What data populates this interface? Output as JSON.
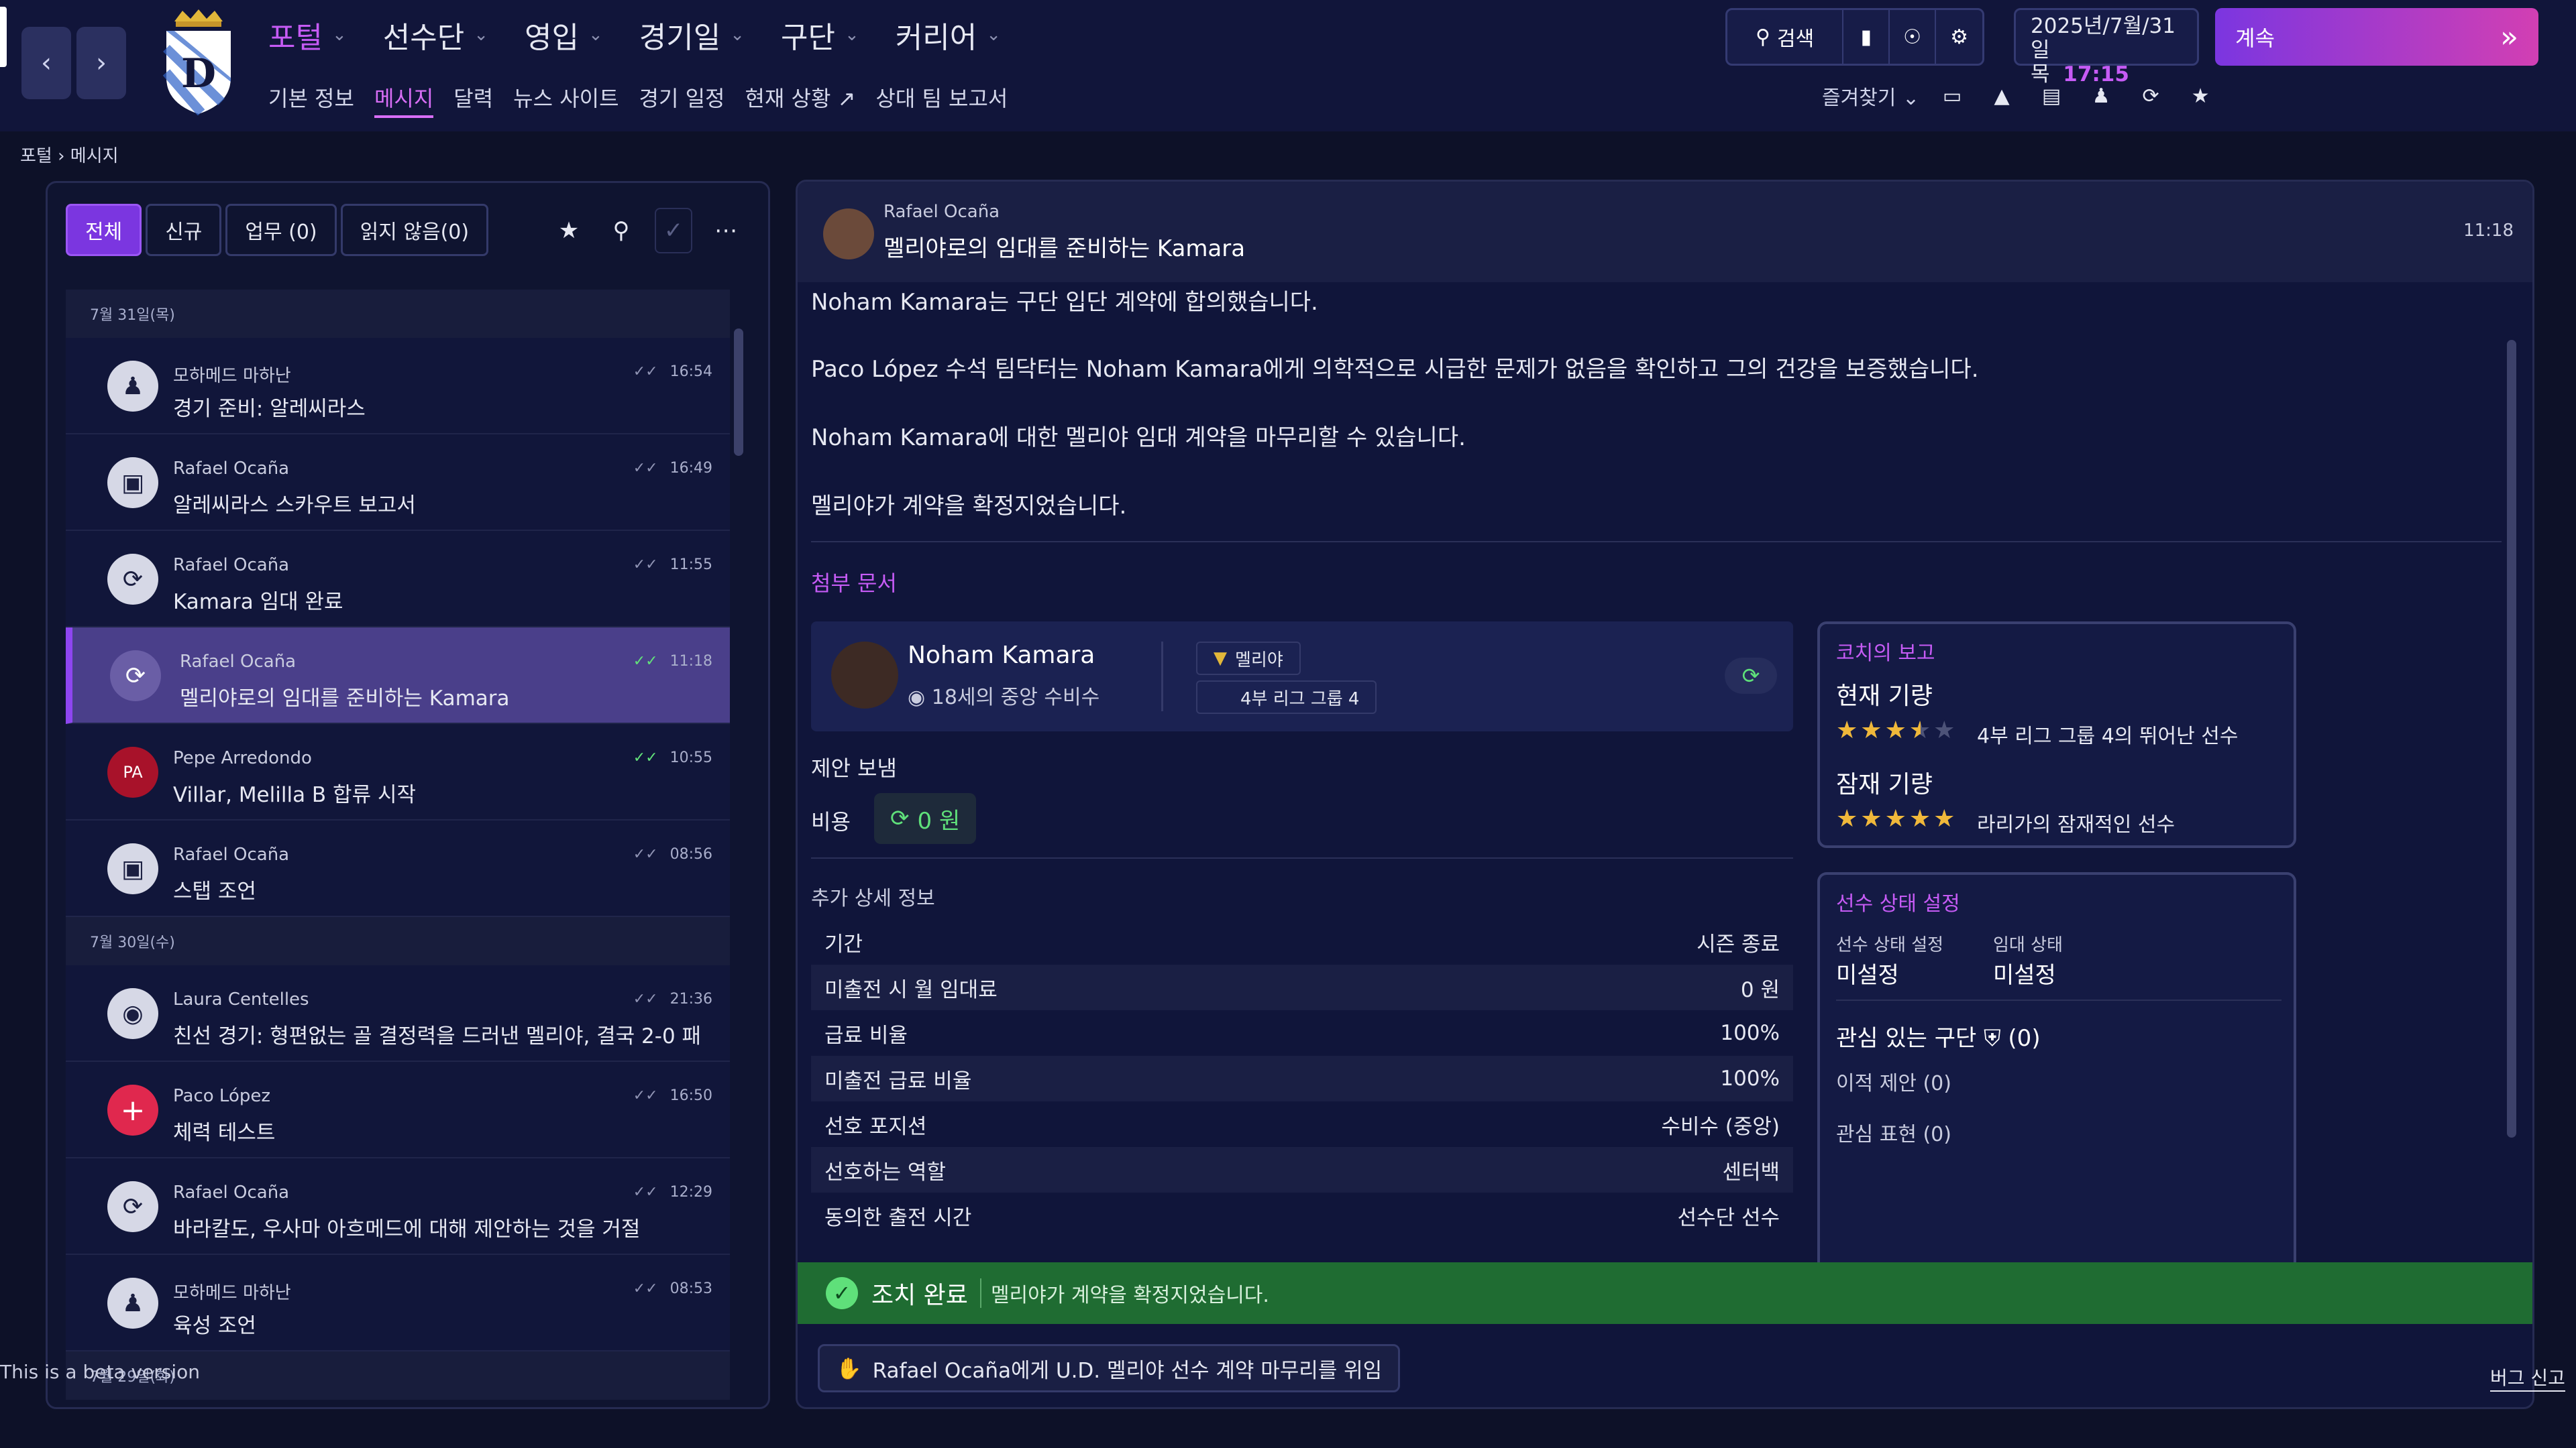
{
  "nav": {
    "main": [
      {
        "label": "포털",
        "active": true
      },
      {
        "label": "선수단"
      },
      {
        "label": "영입"
      },
      {
        "label": "경기일"
      },
      {
        "label": "구단"
      },
      {
        "label": "커리어"
      }
    ],
    "sub": [
      {
        "label": "기본 정보"
      },
      {
        "label": "메시지",
        "active": true
      },
      {
        "label": "달력"
      },
      {
        "label": "뉴스 사이트"
      },
      {
        "label": "경기 일정"
      },
      {
        "label": "현재 상황"
      },
      {
        "label": "상대 팀 보고서"
      }
    ],
    "search_label": "검색",
    "favorites_label": "즐겨찾기",
    "continue_label": "계속"
  },
  "datetime": {
    "date": "2025년/7월/31일",
    "weekday": "목",
    "time": "17:15"
  },
  "breadcrumb": {
    "root": "포털",
    "current": "메시지"
  },
  "filters": [
    "전체",
    "신규",
    "업무 (0)",
    "읽지 않음(0)"
  ],
  "inbox": {
    "day1": "7월 31일(목)",
    "day2": "7월 30일(수)",
    "day3": "7월 29일(화)",
    "items": [
      {
        "sender": "모하메드 마하난",
        "subject": "경기 준비: 알레씨라스",
        "time": "16:54"
      },
      {
        "sender": "Rafael Ocaña",
        "subject": "알레씨라스 스카우트 보고서",
        "time": "16:49"
      },
      {
        "sender": "Rafael Ocaña",
        "subject": "Kamara 임대 완료",
        "time": "11:55"
      },
      {
        "sender": "Rafael Ocaña",
        "subject": "멜리야로의 임대를 준비하는 Kamara",
        "time": "11:18"
      },
      {
        "sender": "Pepe Arredondo",
        "subject": "Villar, Melilla B 합류 시작",
        "time": "10:55",
        "initials": "PA"
      },
      {
        "sender": "Rafael Ocaña",
        "subject": "스탭 조언",
        "time": "08:56"
      },
      {
        "sender": "Laura Centelles",
        "subject": "친선 경기: 형편없는 골 결정력을 드러낸 멜리야, 결국 2-0 패",
        "time": "21:36"
      },
      {
        "sender": "Paco López",
        "subject": "체력 테스트",
        "time": "16:50"
      },
      {
        "sender": "Rafael Ocaña",
        "subject": "바라칼도, 우사마 아흐메드에 대해 제안하는 것을 거절",
        "time": "12:29"
      },
      {
        "sender": "모하메드 마하난",
        "subject": "육성 조언",
        "time": "08:53"
      }
    ]
  },
  "message": {
    "from": "Rafael Ocaña",
    "title": "멜리야로의 임대를 준비하는 Kamara",
    "time": "11:18",
    "paragraphs": [
      "Noham Kamara는 구단 입단 계약에 합의했습니다.",
      "Paco López 수석 팀닥터는 Noham Kamara에게 의학적으로 시급한 문제가 없음을 확인하고 그의 건강을 보증했습니다.",
      "Noham Kamara에 대한 멜리야 임대 계약을 마무리할 수 있습니다.",
      "멜리야가 계약을 확정지었습니다."
    ],
    "attachments_label": "첨부 문서",
    "player": {
      "name": "Noham Kamara",
      "position": "18세의 중앙 수비수",
      "club": "멜리야",
      "league": "4부 리그 그룹 4"
    },
    "offer_label": "제안 보냄",
    "cost_label": "비용",
    "cost_value": "0 원",
    "extra_label": "추가 상세 정보",
    "details": [
      {
        "k": "기간",
        "v": "시즌 종료"
      },
      {
        "k": "미출전 시 월 임대료",
        "v": "0 원"
      },
      {
        "k": "급료 비율",
        "v": "100%"
      },
      {
        "k": "미출전 급료 비율",
        "v": "100%"
      },
      {
        "k": "선호 포지션",
        "v": "수비수 (중앙)"
      },
      {
        "k": "선호하는 역할",
        "v": "센터백"
      },
      {
        "k": "동의한 출전 시간",
        "v": "선수단 선수"
      }
    ],
    "coach": {
      "title": "코치의 보고",
      "current_label": "현재 기량",
      "current_stars": 3.5,
      "current_desc": "4부 리그 그룹 4의 뛰어난 선수",
      "potential_label": "잠재 기량",
      "potential_stars": 5,
      "potential_desc": "라리가의 잠재적인 선수"
    },
    "status": {
      "title": "선수 상태 설정",
      "k1": "선수 상태 설정",
      "v1": "미설정",
      "k2": "임대 상태",
      "v2": "미설정",
      "interest": "관심 있는 구단",
      "interest_count": "(0)",
      "transfer": "이적 제안 (0)",
      "expressed": "관심 표현 (0)"
    },
    "done_label": "조치 완료",
    "done_msg": "멜리야가 계약을 확정지었습니다.",
    "delegate": "Rafael Ocaña에게 U.D. 멜리야 선수 계약 마무리를 위임"
  },
  "footer": {
    "beta": "This is a beta version",
    "bug": "버그 신고"
  },
  "colors": {
    "accent": "#c65bf5",
    "success": "#1f6c32",
    "star": "#f0b83a"
  }
}
